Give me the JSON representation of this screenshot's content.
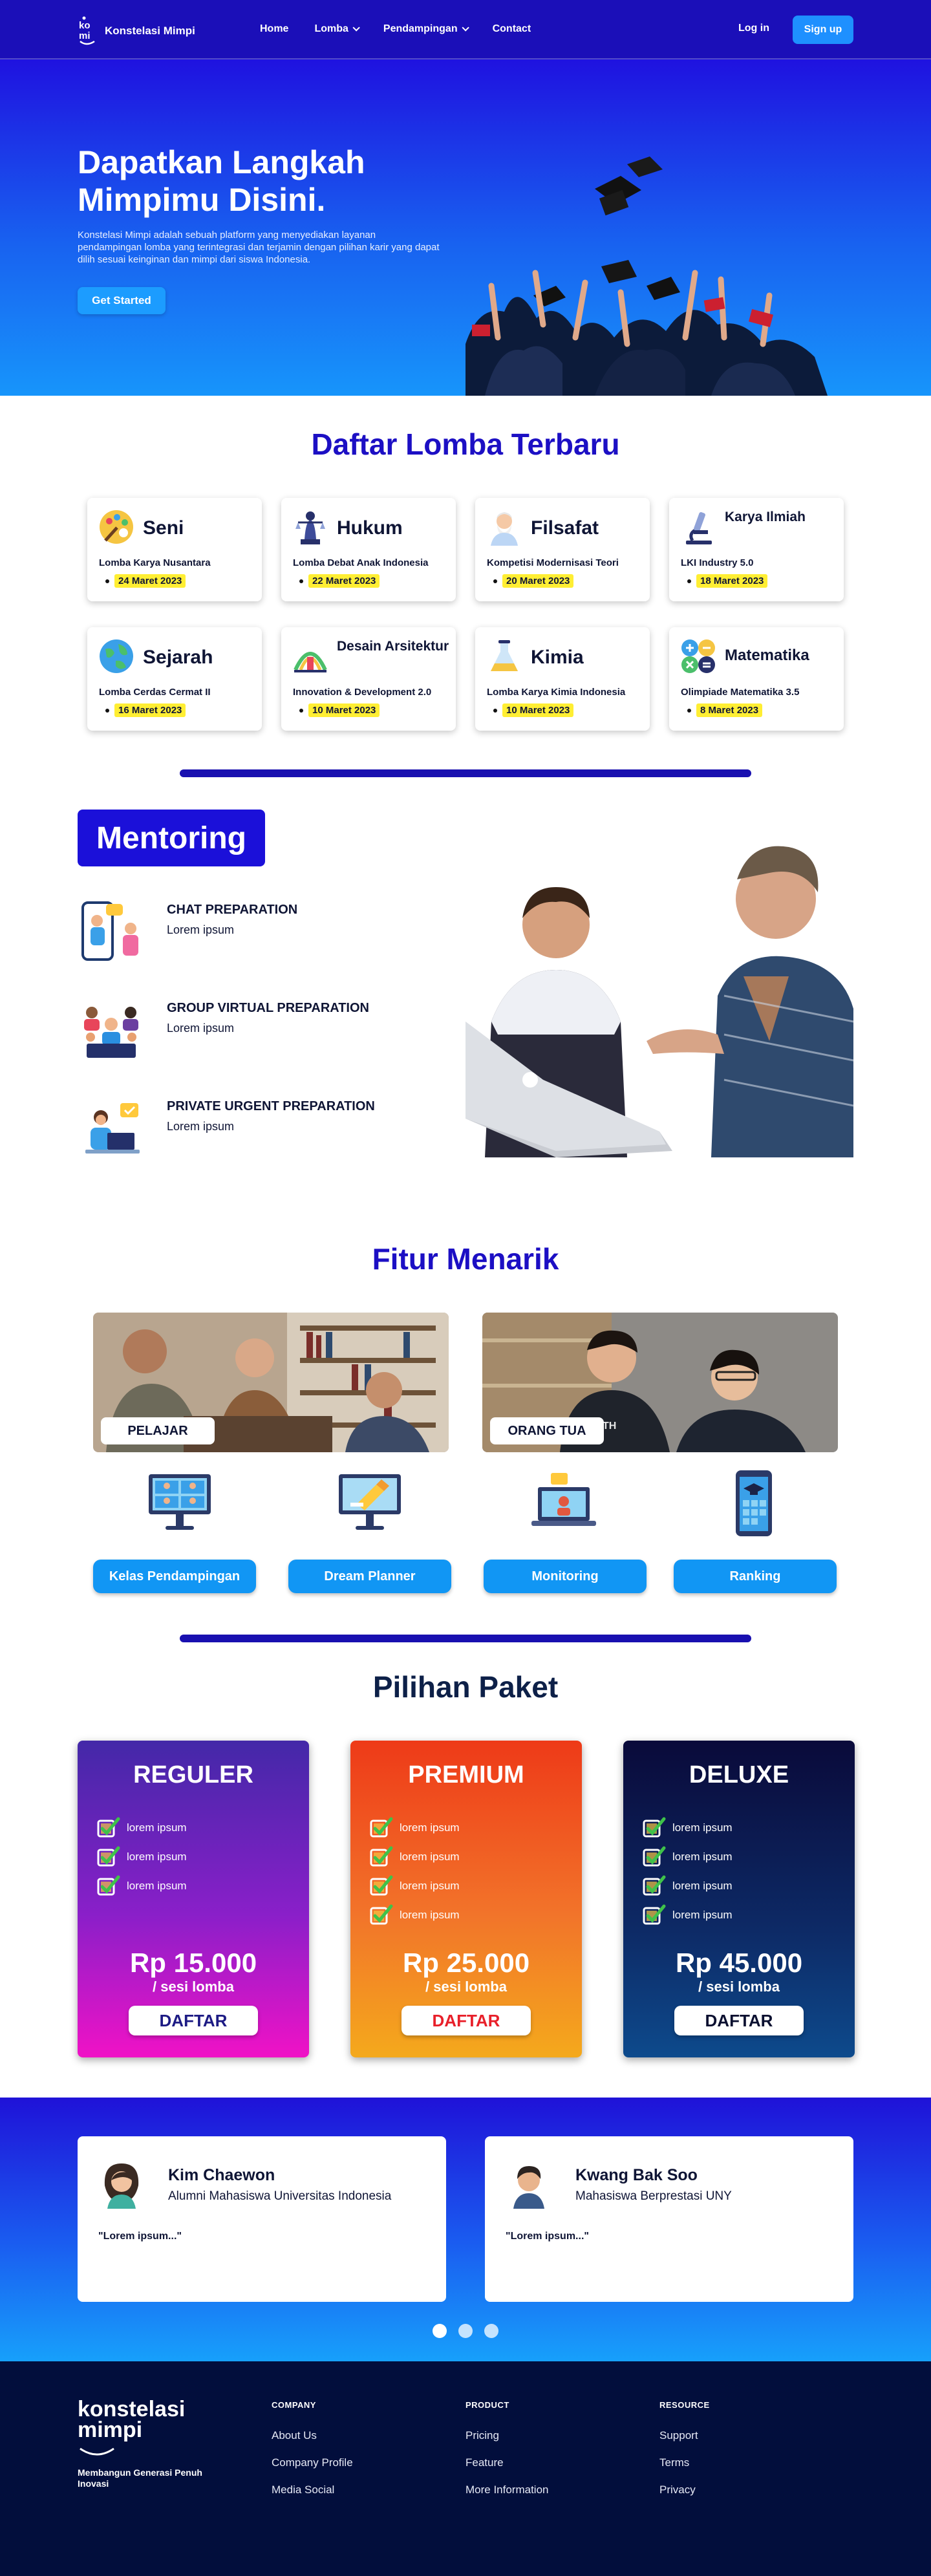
{
  "nav": {
    "brand": "Konstelasi Mimpi",
    "logo_mark": "kom mi",
    "links": [
      "Home",
      "Lomba",
      "Pendampingan",
      "Contact"
    ],
    "login": "Log in",
    "signup": "Sign up"
  },
  "hero": {
    "title": "Dapatkan Langkah Mimpimu Disini.",
    "description": "Konstelasi Mimpi adalah sebuah platform yang menyediakan layanan pendampingan lomba yang terintegrasi dan terjamin dengan pilihan karir yang dapat dilih sesuai keinginan dan mimpi dari siswa Indonesia.",
    "cta": "Get Started"
  },
  "lomba": {
    "title": "Daftar Lomba Terbaru",
    "cards": [
      {
        "category": "Seni",
        "name": "Lomba Karya Nusantara",
        "date": "24 Maret 2023",
        "icon": "palette-icon"
      },
      {
        "category": "Hukum",
        "name": "Lomba Debat Anak Indonesia",
        "date": "22 Maret 2023",
        "icon": "lady-justice-icon"
      },
      {
        "category": "Filsafat",
        "name": "Kompetisi Modernisasi Teori",
        "date": "20 Maret 2023",
        "icon": "philosopher-icon"
      },
      {
        "category": "Karya Ilmiah",
        "name": "LKI Industry 5.0",
        "date": "18 Maret 2023",
        "icon": "microscope-icon"
      },
      {
        "category": "Sejarah",
        "name": "Lomba Cerdas Cermat II",
        "date": "16 Maret 2023",
        "icon": "globe-icon"
      },
      {
        "category": "Desain Arsitektur",
        "name": "Innovation & Development 2.0",
        "date": "10 Maret 2023",
        "icon": "architecture-icon"
      },
      {
        "category": "Kimia",
        "name": "Lomba Karya Kimia Indonesia",
        "date": "10 Maret 2023",
        "icon": "flask-icon"
      },
      {
        "category": "Matematika",
        "name": "Olimpiade Matematika 3.5",
        "date": "8 Maret 2023",
        "icon": "math-operators-icon"
      }
    ]
  },
  "mentoring": {
    "title": "Mentoring",
    "items": [
      {
        "title": "CHAT PREPARATION",
        "desc": "Lorem ipsum",
        "icon": "chat-icon"
      },
      {
        "title": "GROUP VIRTUAL PREPARATION",
        "desc": "Lorem ipsum",
        "icon": "group-call-icon"
      },
      {
        "title": "PRIVATE URGENT PREPARATION",
        "desc": "Lorem ipsum",
        "icon": "private-laptop-icon"
      }
    ]
  },
  "fitur": {
    "title": "Fitur Menarik",
    "photos": [
      {
        "label": "PELAJAR"
      },
      {
        "label": "ORANG TUA"
      }
    ],
    "buttons": [
      {
        "label": "Kelas Pendampingan",
        "icon": "video-class-icon"
      },
      {
        "label": "Dream Planner",
        "icon": "planner-monitor-icon"
      },
      {
        "label": "Monitoring",
        "icon": "monitoring-laptop-icon"
      },
      {
        "label": "Ranking",
        "icon": "ranking-phone-icon"
      }
    ]
  },
  "paket": {
    "title": "Pilihan Paket",
    "plans": [
      {
        "name": "REGULER",
        "features": [
          "lorem ipsum",
          "lorem ipsum",
          "lorem ipsum"
        ],
        "price": "Rp 15.000",
        "per": "/ sesi lomba",
        "button": "DAFTAR",
        "button_color": "#1d1b84"
      },
      {
        "name": "PREMIUM",
        "features": [
          "lorem ipsum",
          "lorem ipsum",
          "lorem ipsum",
          "lorem ipsum"
        ],
        "price": "Rp 25.000",
        "per": "/ sesi lomba",
        "button": "DAFTAR",
        "button_color": "#e8202a"
      },
      {
        "name": "DELUXE",
        "features": [
          "lorem ipsum",
          "lorem ipsum",
          "lorem ipsum",
          "lorem ipsum"
        ],
        "price": "Rp 45.000",
        "per": "/ sesi lomba",
        "button": "DAFTAR",
        "button_color": "#0b1030"
      }
    ]
  },
  "testimoni": [
    {
      "name": "Kim Chaewon",
      "status": "Alumni Mahasiswa Universitas Indonesia",
      "quote": "\"Lorem ipsum...\""
    },
    {
      "name": "Kwang Bak Soo",
      "status": "Mahasiswa Berprestasi UNY",
      "quote": "\"Lorem ipsum...\""
    }
  ],
  "footer": {
    "logo": "konstelasi mimpi",
    "tagline": "Membangun Generasi Penuh Inovasi",
    "columns": [
      {
        "title": "COMPANY",
        "links": [
          "About Us",
          "Company Profile",
          "Media Social"
        ]
      },
      {
        "title": "PRODUCT",
        "links": [
          "Pricing",
          "Feature",
          "More Information"
        ]
      },
      {
        "title": "RESOURCE",
        "links": [
          "Support",
          "Terms",
          "Privacy"
        ]
      }
    ]
  },
  "colors": {
    "primary": "#1b0fb8",
    "accent": "#1196f4",
    "highlight": "#ffee33",
    "footer": "#020e3c"
  }
}
